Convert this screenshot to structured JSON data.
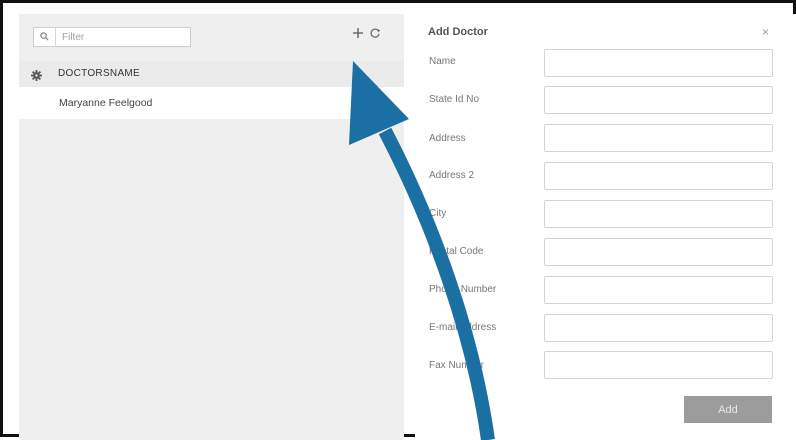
{
  "filter": {
    "placeholder": "Filter"
  },
  "list": {
    "column_header": "DOCTORSNAME",
    "rows": [
      {
        "name": "Maryanne Feelgood"
      }
    ]
  },
  "form": {
    "title": "Add Doctor",
    "close_label": "×",
    "fields": [
      {
        "label": "Name",
        "value": ""
      },
      {
        "label": "State Id No",
        "value": ""
      },
      {
        "label": "Address",
        "value": ""
      },
      {
        "label": "Address 2",
        "value": ""
      },
      {
        "label": "City",
        "value": ""
      },
      {
        "label": "Postal Code",
        "value": ""
      },
      {
        "label": "Phone Number",
        "value": ""
      },
      {
        "label": "E-mail Address",
        "value": ""
      },
      {
        "label": "Fax Number",
        "value": ""
      }
    ],
    "submit_label": "Add"
  },
  "icons": {
    "search": "search-icon",
    "add": "plus-icon",
    "refresh": "refresh-icon",
    "settings": "gear-icon",
    "close": "close-icon"
  },
  "colors": {
    "annotation_arrow": "#1a6fa3",
    "add_button": "#9c9c9c",
    "left_panel_bg": "#efefef"
  }
}
